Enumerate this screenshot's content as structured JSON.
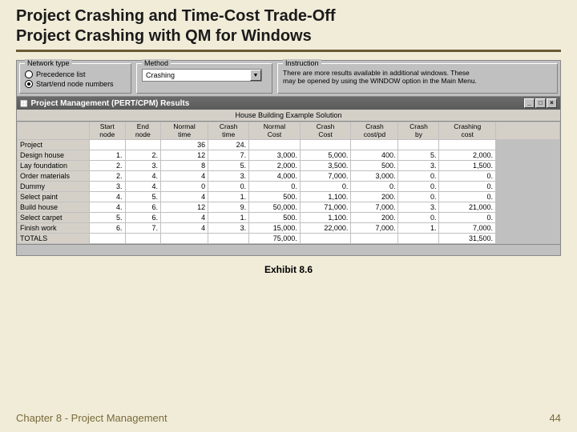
{
  "title": {
    "line1": "Project Crashing and Time-Cost Trade-Off",
    "line2": "Project Crashing with QM for Windows"
  },
  "panels": {
    "network_legend": "Network type",
    "radio1": "Precedence list",
    "radio2": "Start/end node numbers",
    "method_legend": "Method",
    "method_value": "Crashing",
    "instr_legend": "Instruction",
    "instr_text": "There are more results available in additional windows. These may be opened by using the WINDOW option in the Main Menu."
  },
  "window": {
    "title": "Project Management (PERT/CPM) Results",
    "subtitle": "House Building Example Solution"
  },
  "headers": [
    "",
    "Start node",
    "End node",
    "Normal time",
    "Crash time",
    "Normal Cost",
    "Crash Cost",
    "Crash cost/pd",
    "Crash by",
    "Crashing cost",
    ""
  ],
  "rows": [
    {
      "lbl": "Project",
      "c": [
        "",
        "",
        "36",
        "24.",
        "",
        "",
        "",
        "",
        ""
      ]
    },
    {
      "lbl": "Design house",
      "c": [
        "1.",
        "2.",
        "12",
        "7.",
        "3,000.",
        "5,000.",
        "400.",
        "5.",
        "2,000."
      ]
    },
    {
      "lbl": "Lay foundation",
      "c": [
        "2.",
        "3.",
        "8",
        "5.",
        "2,000.",
        "3,500.",
        "500.",
        "3.",
        "1,500."
      ]
    },
    {
      "lbl": "Order materials",
      "c": [
        "2.",
        "4.",
        "4",
        "3.",
        "4,000.",
        "7,000.",
        "3,000.",
        "0.",
        "0."
      ]
    },
    {
      "lbl": "Dummy",
      "c": [
        "3.",
        "4.",
        "0",
        "0.",
        "0.",
        "0.",
        "0.",
        "0.",
        "0."
      ]
    },
    {
      "lbl": "Select paint",
      "c": [
        "4.",
        "5.",
        "4",
        "1.",
        "500.",
        "1,100.",
        "200.",
        "0.",
        "0."
      ]
    },
    {
      "lbl": "Build house",
      "c": [
        "4.",
        "6.",
        "12",
        "9.",
        "50,000.",
        "71,000.",
        "7,000.",
        "3.",
        "21,000."
      ]
    },
    {
      "lbl": "Select carpet",
      "c": [
        "5.",
        "6.",
        "4",
        "1.",
        "500.",
        "1,100.",
        "200.",
        "0.",
        "0."
      ]
    },
    {
      "lbl": "Finish work",
      "c": [
        "6.",
        "7.",
        "4",
        "3.",
        "15,000.",
        "22,000.",
        "7,000.",
        "1.",
        "7,000."
      ]
    },
    {
      "lbl": "TOTALS",
      "c": [
        "",
        "",
        "",
        "",
        "75,000.",
        "",
        "",
        "",
        "31,500."
      ]
    }
  ],
  "exhibit": "Exhibit 8.6",
  "footer": {
    "left": "Chapter 8 - Project Management",
    "right": "44"
  }
}
